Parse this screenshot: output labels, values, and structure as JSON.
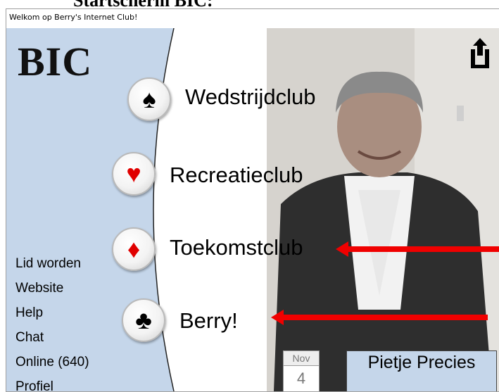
{
  "document": {
    "heading": "Startscherm BIC:"
  },
  "window": {
    "title": "Welkom op Berry's Internet Club!"
  },
  "logo": {
    "text": "BIC"
  },
  "toolbar": {
    "share_icon": "share-icon"
  },
  "clubs": [
    {
      "label": "Wedstrijdclub",
      "suit": "♠",
      "suit_name": "spade-icon",
      "suit_color": "#000000"
    },
    {
      "label": "Recreatieclub",
      "suit": "♥",
      "suit_name": "heart-icon",
      "suit_color": "#e00000"
    },
    {
      "label": "Toekomstclub",
      "suit": "♦",
      "suit_name": "diamond-icon",
      "suit_color": "#e00000"
    },
    {
      "label": "Berry!",
      "suit": "♣",
      "suit_name": "club-icon",
      "suit_color": "#000000"
    }
  ],
  "menu": [
    {
      "label": "Lid worden"
    },
    {
      "label": "Website"
    },
    {
      "label": "Help"
    },
    {
      "label": "Chat"
    },
    {
      "label": "Online (640)"
    },
    {
      "label": "Profiel"
    }
  ],
  "calendar": {
    "month": "Nov",
    "day": "4"
  },
  "user": {
    "name": "Pietje Precies"
  },
  "colors": {
    "sidebar": "#c5d6ea",
    "arrow": "#f00000",
    "user_box": "#c5d6ea"
  }
}
